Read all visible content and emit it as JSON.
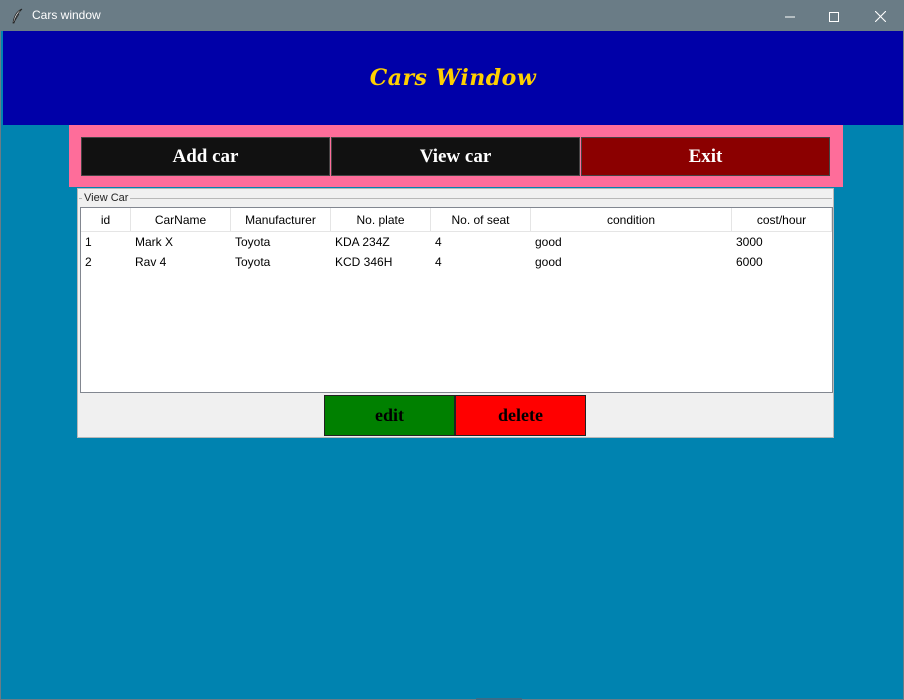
{
  "window": {
    "title": "Cars window",
    "controls": {
      "minimize_icon": "minimize-icon",
      "maximize_icon": "maximize-icon",
      "close_icon": "close-icon"
    }
  },
  "header": {
    "title": "Cars Window",
    "title_color": "#ffd000",
    "background": "#0000a8"
  },
  "menu": {
    "add_label": "Add car",
    "view_label": "View car",
    "exit_label": "Exit",
    "frame_color": "#fe6d9a"
  },
  "view_panel": {
    "legend": "View Car",
    "columns": [
      "id",
      "CarName",
      "Manufacturer",
      "No. plate",
      "No. of seat",
      "condition",
      "cost/hour"
    ],
    "rows": [
      [
        "1",
        "Mark X",
        "Toyota",
        "KDA 234Z",
        "4",
        "good",
        "3000"
      ],
      [
        "2",
        "Rav 4",
        "Toyota",
        "KCD 346H",
        "4",
        "good",
        "6000"
      ]
    ],
    "edit_label": "edit",
    "delete_label": "delete"
  },
  "colors": {
    "background": "#0083b0",
    "edit_button": "#008000",
    "delete_button": "#ff0000",
    "exit_button": "#8b0000",
    "menu_button": "#111111"
  }
}
